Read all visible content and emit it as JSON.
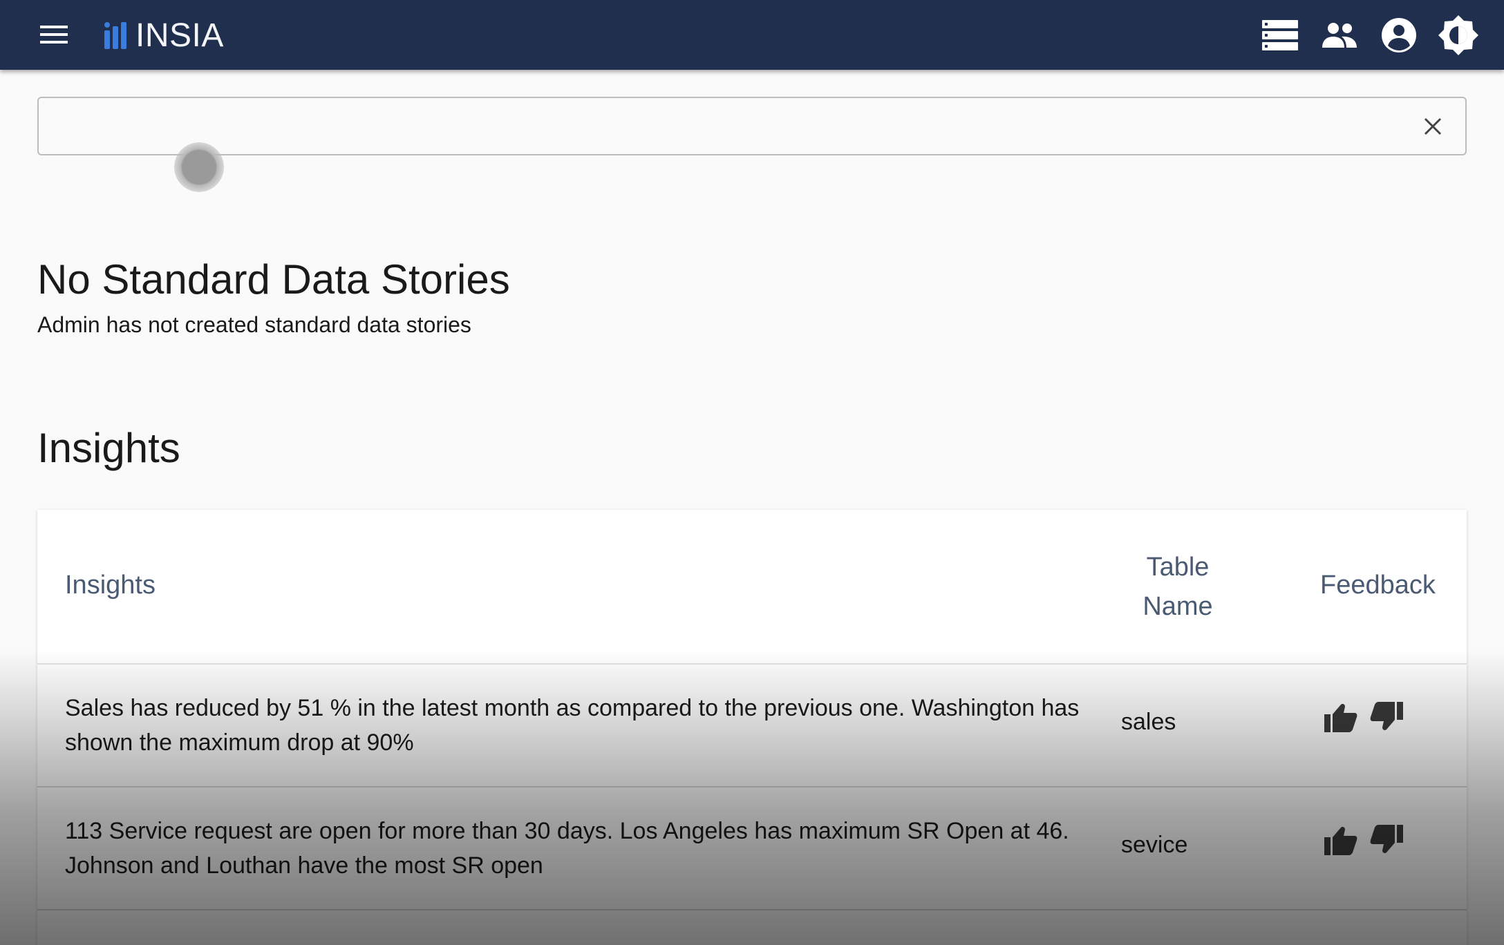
{
  "app": {
    "name": "INSIA"
  },
  "search": {
    "value": "",
    "placeholder": ""
  },
  "standard_stories": {
    "title": "No Standard Data Stories",
    "subtitle": "Admin has not created standard data stories"
  },
  "insights_section": {
    "title": "Insights"
  },
  "table": {
    "headers": {
      "insights": "Insights",
      "table_name_line1": "Table",
      "table_name_line2": "Name",
      "feedback": "Feedback"
    },
    "rows": [
      {
        "insight": "Sales has reduced by 51 % in the latest month as compared to the previous one. Washington has shown the maximum drop at 90%",
        "table_name": "sales"
      },
      {
        "insight": "113 Service request are open for more than 30 days. Los Angeles has maximum SR Open at 46. Johnson and Louthan have the most SR open",
        "table_name": "sevice"
      }
    ]
  },
  "icons": {
    "menu": "menu-icon",
    "logo": "bar-chart-logo-icon",
    "list": "list-icon",
    "people": "people-icon",
    "account": "account-circle-icon",
    "theme": "brightness-icon",
    "clear": "close-icon",
    "thumb_up": "thumb-up-icon",
    "thumb_down": "thumb-down-icon"
  },
  "colors": {
    "topbar": "#1f2f4d",
    "logo_accent": "#3b7ddd",
    "header_text": "#4b5a73"
  }
}
